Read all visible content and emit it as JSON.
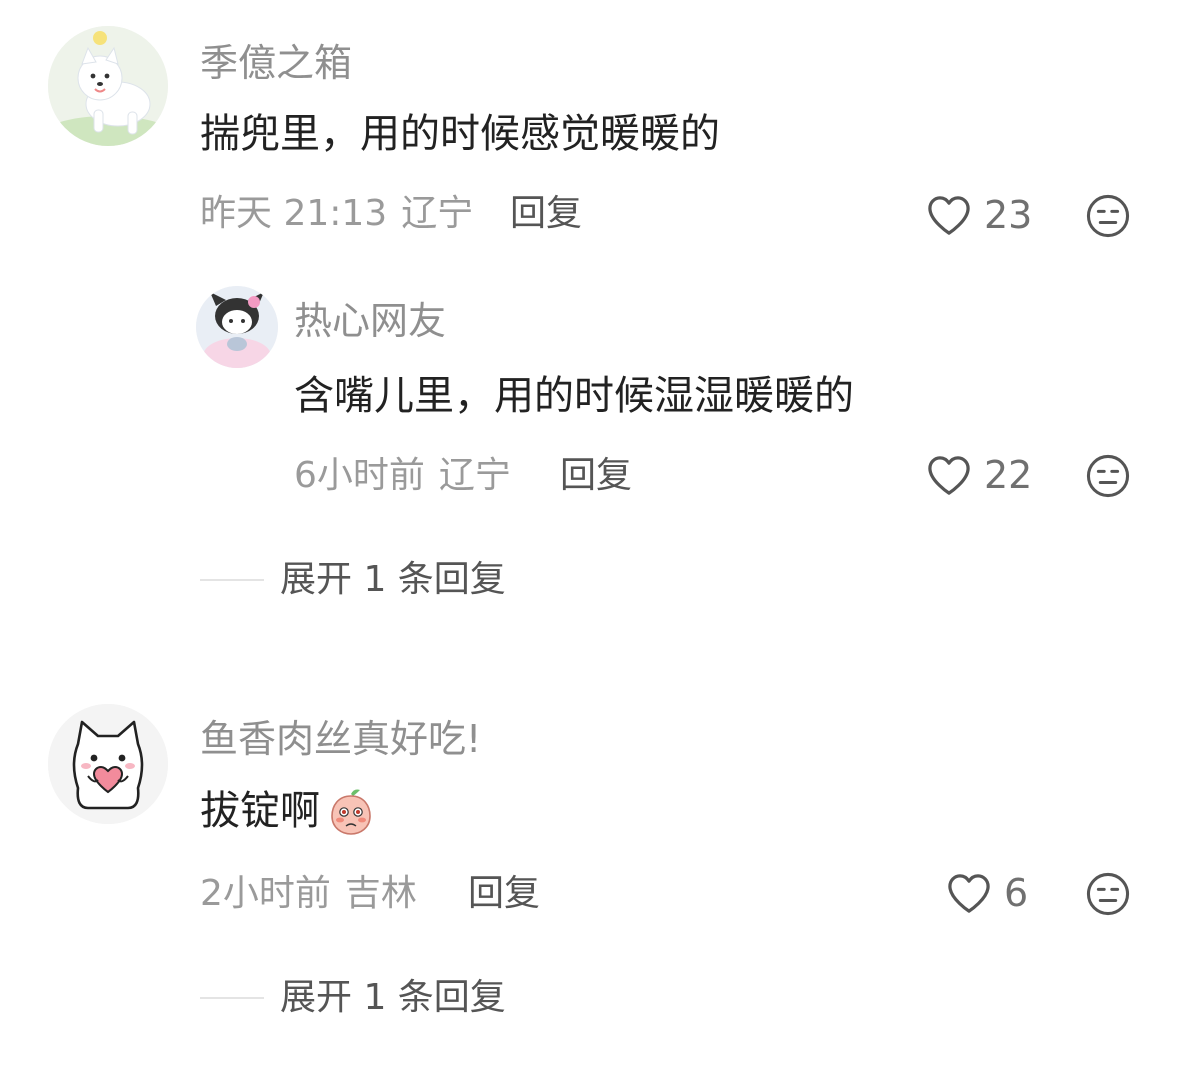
{
  "comments": [
    {
      "username": "季億之箱",
      "avatar_icon": "samoyed-dog-avatar",
      "text": "揣兜里，用的时候感觉暖暖的",
      "time": "昨天 21:13",
      "location": "辽宁",
      "reply_label": "回复",
      "likes": "23",
      "replies": [
        {
          "username": "热心网友",
          "avatar_icon": "kuromi-avatar",
          "text": "含嘴儿里，用的时候湿湿暖暖的",
          "time": "6小时前",
          "location": "辽宁",
          "reply_label": "回复",
          "likes": "22"
        }
      ],
      "expand_label": "展开 1 条回复"
    },
    {
      "username": "鱼香肉丝真好吃!",
      "avatar_icon": "white-cat-heart-avatar",
      "text": "拔锭啊",
      "emoji": "peach-shy-emoji",
      "time": "2小时前",
      "location": "吉林",
      "reply_label": "回复",
      "likes": "6",
      "expand_label": "展开 1 条回复"
    }
  ],
  "colors": {
    "username": "#8f8f8f",
    "content": "#222222",
    "meta": "#9a9a9a",
    "reply": "#555555",
    "icon": "#555555"
  }
}
